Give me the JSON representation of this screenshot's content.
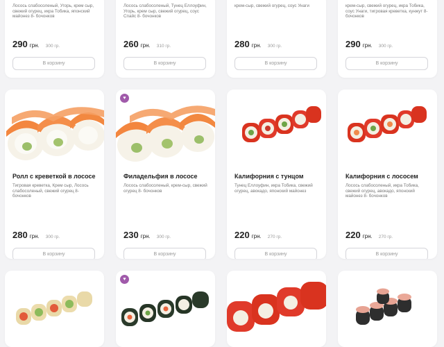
{
  "products": [
    {
      "title": "",
      "desc": "Лосось слабосоленый, Угорь, крем сыр, свежий огурец, икра Тобика, японский майонез 8- бочонков",
      "price": "290",
      "currency": "грн.",
      "weight": "300 гр.",
      "button": "В корзину",
      "favorite": false
    },
    {
      "title": "",
      "desc": "Лосось слабосоленый, Тунец Еллоуфин, Угорь, крем сыр, свежий огурец, соус Спайс 8- бочонков",
      "price": "260",
      "currency": "грн.",
      "weight": "310 гр.",
      "button": "В корзину",
      "favorite": false
    },
    {
      "title": "",
      "desc": "крем-сыр, свежий огурец, соус Унаги",
      "price": "280",
      "currency": "грн.",
      "weight": "300 гр.",
      "button": "В корзину",
      "favorite": false
    },
    {
      "title": "",
      "desc": "крем-сыр, свежий огурец, икра Тобика, соус Унаги, тигровая креветка, кунжут 8- бочонков",
      "price": "290",
      "currency": "грн.",
      "weight": "300 гр.",
      "button": "В корзину",
      "favorite": false
    },
    {
      "title": "Ролл с креветкой в лососе",
      "desc": "Тигровая креветка, Крем сыр, Лосось слабосоленый, свежий огурец 8- бочонков",
      "price": "280",
      "currency": "грн.",
      "weight": "300 гр.",
      "button": "В корзину",
      "favorite": false,
      "image": "salmon-roll"
    },
    {
      "title": "Филадельфия в лососе",
      "desc": "Лосось слабосоленый, крем-сыр, свежий огурец 8- бочонков",
      "price": "230",
      "currency": "грн.",
      "weight": "300 гр.",
      "button": "В корзину",
      "favorite": true,
      "image": "salmon-roll"
    },
    {
      "title": "Калифорния с тунцом",
      "desc": "Тунец Еллоуфин, икра Тобика, свежий огурец, авокадо, японский майонез",
      "price": "220",
      "currency": "грн.",
      "weight": "270 гр.",
      "button": "В корзину",
      "favorite": false,
      "image": "tobiko-roll"
    },
    {
      "title": "Калифорния с лососем",
      "desc": "Лосось слабосоленый, икра Тобика, свежий огурец, авокадо, японский майонез 8- бочонков",
      "price": "220",
      "currency": "грн.",
      "weight": "270 гр.",
      "button": "В корзину",
      "favorite": false,
      "image": "tobiko-roll"
    },
    {
      "favorite": false,
      "image": "sesame-roll"
    },
    {
      "favorite": true,
      "image": "nori-roll"
    },
    {
      "favorite": false,
      "image": "tobiko-big"
    },
    {
      "favorite": false,
      "image": "dark-roll"
    }
  ],
  "colors": {
    "accent": "#a05aaa",
    "salmon": "#f08a4b",
    "tobiko": "#e03a2a"
  }
}
